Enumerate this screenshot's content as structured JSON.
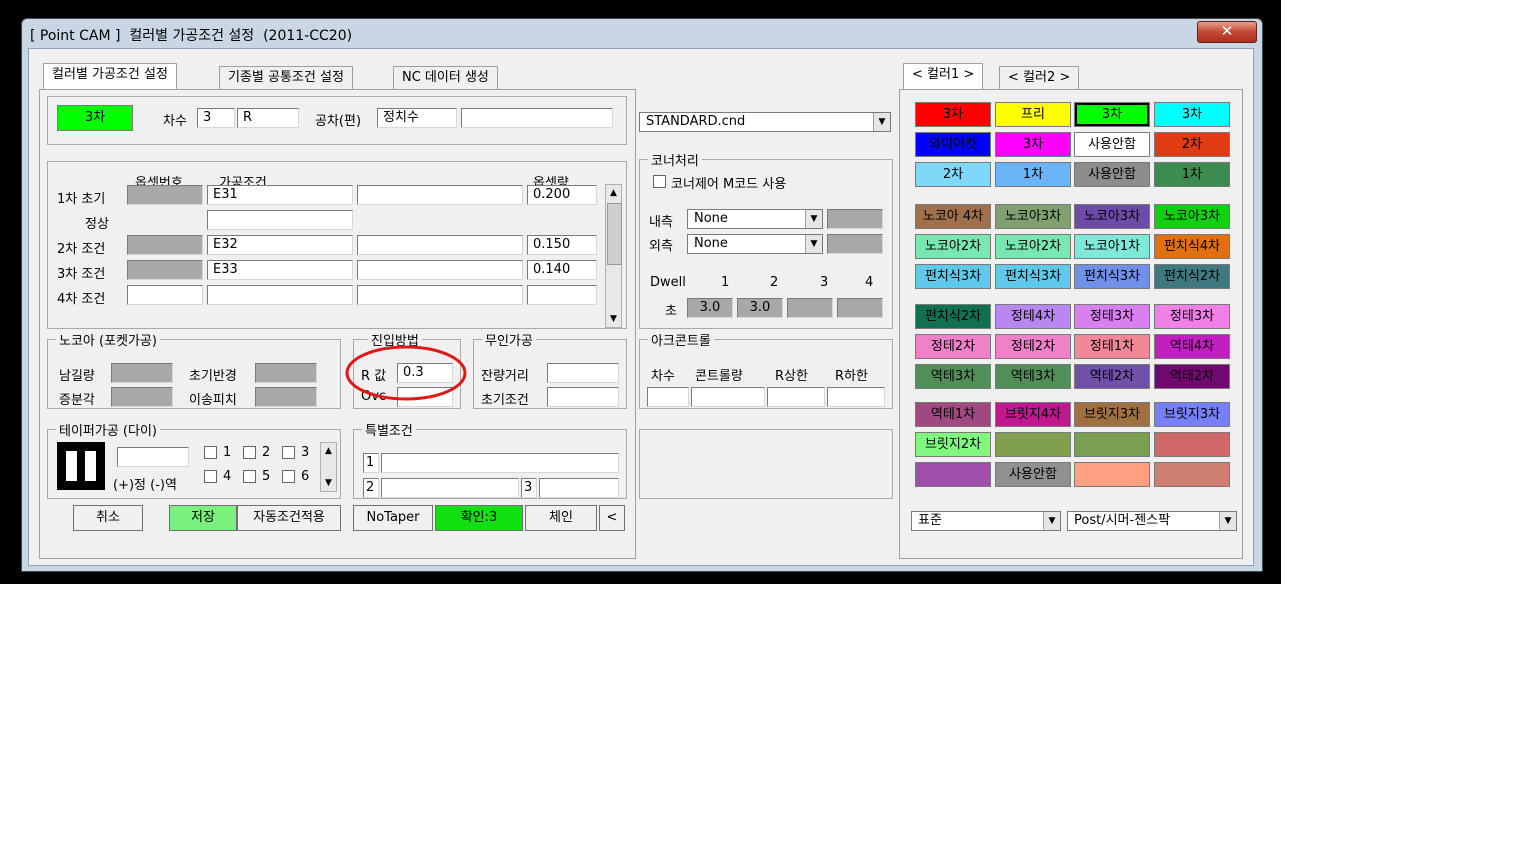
{
  "window": {
    "title": "[ Point CAM ]  컬러별 가공조건 설정  (2011-CC20)",
    "close": "✕"
  },
  "tabs": [
    "컬러별 가공조건 설정",
    "기종별 공통조건 설정",
    "NC 데이터 생성"
  ],
  "color_tabs": [
    "< 컬러1 >",
    "< 컬러2 >"
  ],
  "header": {
    "selected_color_label": "3차",
    "selected_color": "#00ff00",
    "order_label": "차수",
    "order_value": "3",
    "r_value": "R",
    "tolerance_label": "공차(편)",
    "tolerance_value": "정치수",
    "tolerance_extra": ""
  },
  "cnd_file": "STANDARD.cnd",
  "conditions": {
    "col_offset_no": "옵셋번호",
    "col_condition": "가공조건",
    "col_offset": "옵셋량",
    "rows": [
      {
        "label": "1차 초기",
        "condition": "E31",
        "offset": "0.200"
      },
      {
        "label": "정상",
        "condition": "",
        "offset": ""
      },
      {
        "label": "2차 조건",
        "condition": "E32",
        "offset": "0.150"
      },
      {
        "label": "3차 조건",
        "condition": "E33",
        "offset": "0.140"
      },
      {
        "label": "4차 조건",
        "condition": "",
        "offset": ""
      }
    ]
  },
  "corner": {
    "title": "코너처리",
    "mcode_label": "코너제어 M코드 사용",
    "inner_label": "내측",
    "inner_value": "None",
    "outer_label": "외측",
    "outer_value": "None",
    "dwell_label": "Dwell",
    "dwell_cols": [
      "1",
      "2",
      "3",
      "4"
    ],
    "sec_label": "초",
    "dwell_values": [
      "3.0",
      "3.0",
      "",
      ""
    ]
  },
  "nocore": {
    "title": "노코아 (포켓가공)",
    "remain": "남길량",
    "init_reflect": "초기반경",
    "step_angle": "증분각",
    "move_pitch": "이송피치"
  },
  "approach": {
    "title": "진입방법",
    "r_label": "R 값",
    "r_value": "0.3",
    "ovc_label": "Ovc",
    "ovc_value": ""
  },
  "unattended": {
    "title": "무인가공",
    "remain_dist": "잔량거리",
    "init_cond": "초기조건"
  },
  "arc": {
    "title": "아크콘트롤",
    "cols": [
      "차수",
      "콘트롤량",
      "R상한",
      "R하한"
    ]
  },
  "taper": {
    "title": "테이퍼가공 (다이)",
    "value": "",
    "direction": "(+)정 (-)역",
    "checks": [
      "1",
      "2",
      "3",
      "4",
      "5",
      "6"
    ]
  },
  "special": {
    "title": "특별조건",
    "nums": [
      "1",
      "2",
      "3"
    ]
  },
  "buttons": {
    "cancel": "취소",
    "save": "저장",
    "auto_apply": "자동조건적용",
    "no_taper": "NoTaper",
    "confirm": "확인:3",
    "chain": "체인",
    "prev": "<"
  },
  "bottom_combos": {
    "standard": "표준",
    "post": "Post/시머-젠스팍"
  },
  "palette": [
    [
      {
        "label": "3차",
        "color": "#ff0000"
      },
      {
        "label": "프리",
        "color": "#ffff00"
      },
      {
        "label": "3차",
        "color": "#00ff00"
      },
      {
        "label": "3차",
        "color": "#00ffff"
      },
      {
        "label": "와이어컷",
        "color": "#0000ff"
      },
      {
        "label": "3차",
        "color": "#ff00ff"
      },
      {
        "label": "사용안함",
        "color": "#ffffff"
      },
      {
        "label": "2차",
        "color": "#e03c14"
      },
      {
        "label": "2차",
        "color": "#80d8f8"
      },
      {
        "label": "1차",
        "color": "#6cb4f8"
      },
      {
        "label": "사용안함",
        "color": "#8c8c8c"
      },
      {
        "label": "1차",
        "color": "#3c8c50"
      }
    ],
    [
      {
        "label": "노코아 4차",
        "color": "#a0704c"
      },
      {
        "label": "노코아3차",
        "color": "#80a070"
      },
      {
        "label": "노코아3차",
        "color": "#6c4ca8"
      },
      {
        "label": "노코아3차",
        "color": "#10d010"
      },
      {
        "label": "노코아2차",
        "color": "#78e8b0"
      },
      {
        "label": "노코아2차",
        "color": "#78e8b0"
      },
      {
        "label": "노코아1차",
        "color": "#80e8d8"
      },
      {
        "label": "펀치식4차",
        "color": "#e07010"
      },
      {
        "label": "펀치식3차",
        "color": "#60c8e8"
      },
      {
        "label": "펀치식3차",
        "color": "#60c8e8"
      },
      {
        "label": "펀치식3차",
        "color": "#7090e8"
      },
      {
        "label": "펀치식2차",
        "color": "#407880"
      }
    ],
    [
      {
        "label": "펀치식2차",
        "color": "#107050"
      },
      {
        "label": "정테4차",
        "color": "#b888f0"
      },
      {
        "label": "정테3차",
        "color": "#d880f0"
      },
      {
        "label": "정테3차",
        "color": "#f080e8"
      },
      {
        "label": "정테2차",
        "color": "#f080c8"
      },
      {
        "label": "정테2차",
        "color": "#f080c8"
      },
      {
        "label": "정테1차",
        "color": "#f08898"
      },
      {
        "label": "역테4차",
        "color": "#c020c0"
      },
      {
        "label": "역테3차",
        "color": "#509058"
      },
      {
        "label": "역테3차",
        "color": "#509058"
      },
      {
        "label": "역테2차",
        "color": "#7050a8"
      },
      {
        "label": "역테2차",
        "color": "#700870"
      }
    ],
    [
      {
        "label": "역테1차",
        "color": "#a04880"
      },
      {
        "label": "브릿지4차",
        "color": "#c01890"
      },
      {
        "label": "브릿지3차",
        "color": "#a07040"
      },
      {
        "label": "브릿지3차",
        "color": "#7880f8"
      },
      {
        "label": "브릿지2차",
        "color": "#80f880"
      },
      {
        "label": "",
        "color": "#80a050"
      },
      {
        "label": "",
        "color": "#78a050"
      },
      {
        "label": "",
        "color": "#d06868"
      },
      {
        "label": "",
        "color": "#a050a8"
      },
      {
        "label": "사용안함",
        "color": "#909090"
      },
      {
        "label": "",
        "color": "#ffa080"
      },
      {
        "label": "",
        "color": "#d08070"
      }
    ]
  ]
}
